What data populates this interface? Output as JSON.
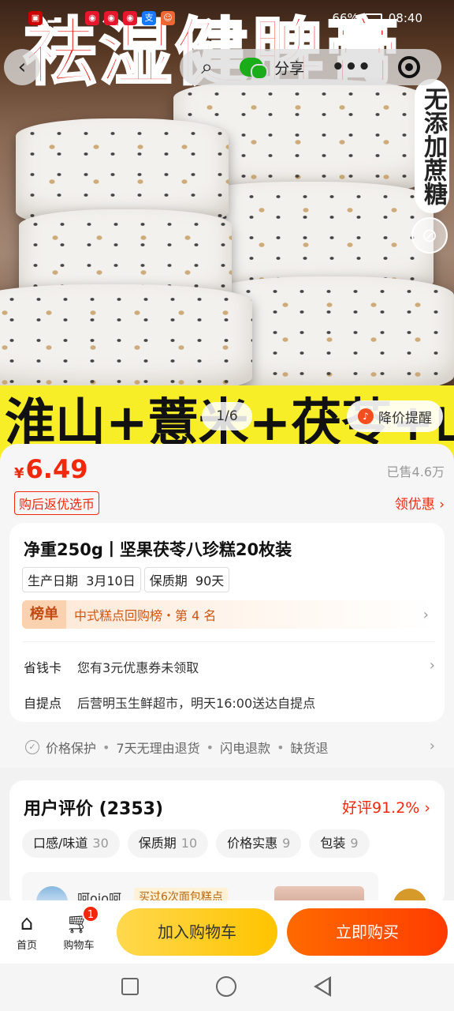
{
  "status_bar": {
    "left_icons": [
      "sim-icon",
      "signal-icon",
      "wifi-icon",
      "weibo-icon",
      "weibo-icon",
      "weibo-icon",
      "alipay-icon",
      "app-icon"
    ],
    "battery": "66%",
    "time": "08:40"
  },
  "hero": {
    "headline": "祛湿健脾膏",
    "side_badge": "无添加蔗糖",
    "ingredients": "淮山+薏米+茯苓+山药",
    "pager": "1/6",
    "price_alert": "降价提醒"
  },
  "nav": {
    "share_label": "分享"
  },
  "price": {
    "currency": "¥",
    "value": "6.49",
    "sold": "已售4.6万",
    "rebate_tag": "购后返优选币",
    "coupon_link": "领优惠"
  },
  "product": {
    "title": "净重250g丨坚果茯苓八珍糕20枚装",
    "tags": [
      {
        "label": "生产日期",
        "value": "3月10日"
      },
      {
        "label": "保质期",
        "value": "90天"
      }
    ],
    "rank": {
      "badge": "榜单",
      "text": "中式糕点回购榜・第 4 名"
    },
    "savings": {
      "label": "省钱卡",
      "value": "您有3元优惠券未领取"
    },
    "pickup": {
      "label": "自提点",
      "value": "后营明玉生鲜超市，明天16:00送达自提点"
    }
  },
  "services": [
    "价格保护",
    "7天无理由退货",
    "闪电退款",
    "缺货退"
  ],
  "reviews": {
    "title": "用户评价 (2353)",
    "good_rate": "好评91.2%",
    "chips": [
      {
        "label": "口感/味道",
        "count": "30"
      },
      {
        "label": "保质期",
        "count": "10"
      },
      {
        "label": "价格实惠",
        "count": "9"
      },
      {
        "label": "包装",
        "count": "9"
      }
    ],
    "preview": {
      "name": "呵ojo呵",
      "tag": "买过6次面包糕点"
    }
  },
  "bottom_bar": {
    "home": "首页",
    "cart": "购物车",
    "cart_count": "1",
    "add_to_cart": "加入购物车",
    "buy_now": "立即购买"
  }
}
